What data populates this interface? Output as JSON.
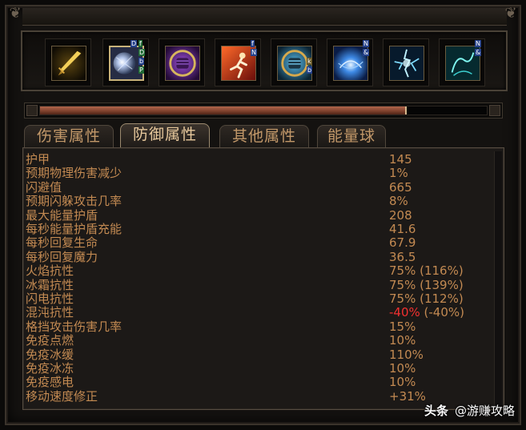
{
  "skill_slots": [
    {
      "icon": "golden-blade-icon",
      "tags": []
    },
    {
      "icon": "frost-orb-icon",
      "tags": [
        "D",
        "f",
        "D",
        "b",
        "P"
      ],
      "selected": true
    },
    {
      "icon": "violet-fist-icon",
      "tags": []
    },
    {
      "icon": "fire-runner-icon",
      "tags": [
        "f",
        "N"
      ]
    },
    {
      "icon": "blue-fist-icon",
      "tags": [
        "k",
        "b"
      ]
    },
    {
      "icon": "blue-vortex-icon",
      "tags": [
        "N",
        "&"
      ]
    },
    {
      "icon": "lightning-burst-icon",
      "tags": []
    },
    {
      "icon": "cyan-wisp-icon",
      "tags": [
        "N",
        "&"
      ]
    }
  ],
  "scroll_position": 0.82,
  "tabs": [
    {
      "label": "伤害属性",
      "active": false
    },
    {
      "label": "防御属性",
      "active": true
    },
    {
      "label": "其他属性",
      "active": false
    },
    {
      "label": "能量球",
      "active": false
    }
  ],
  "stats": [
    {
      "label": "护甲",
      "value": "145"
    },
    {
      "label": "预期物理伤害减少",
      "value": "1%"
    },
    {
      "label": "闪避值",
      "value": "665"
    },
    {
      "label": "预期闪躲攻击几率",
      "value": "8%"
    },
    {
      "label": "最大能量护盾",
      "value": "208"
    },
    {
      "label": "每秒能量护盾充能",
      "value": "41.6"
    },
    {
      "label": "每秒回复生命",
      "value": "67.9"
    },
    {
      "label": "每秒回复魔力",
      "value": "36.5"
    },
    {
      "label": "火焰抗性",
      "value": "75% (116%)"
    },
    {
      "label": "冰霜抗性",
      "value": "75% (139%)"
    },
    {
      "label": "闪电抗性",
      "value": "75% (112%)"
    },
    {
      "label": "混沌抗性",
      "value": "-40%",
      "value_extra": " (-40%)",
      "negative": true
    },
    {
      "label": "格挡攻击伤害几率",
      "value": "15%"
    },
    {
      "label": "免疫点燃",
      "value": "10%"
    },
    {
      "label": "免疫冰缓",
      "value": "110%"
    },
    {
      "label": "免疫冰冻",
      "value": "10%"
    },
    {
      "label": "免疫感电",
      "value": "10%"
    },
    {
      "label": "移动速度修正",
      "value": "+31%"
    }
  ],
  "watermark": {
    "brand": "头条",
    "handle": "@游赚攻略"
  },
  "colors": {
    "stat_text": "#c38a52",
    "negative": "#f23030",
    "tab_text": "#c29869",
    "tab_active_text": "#e7c89c"
  }
}
